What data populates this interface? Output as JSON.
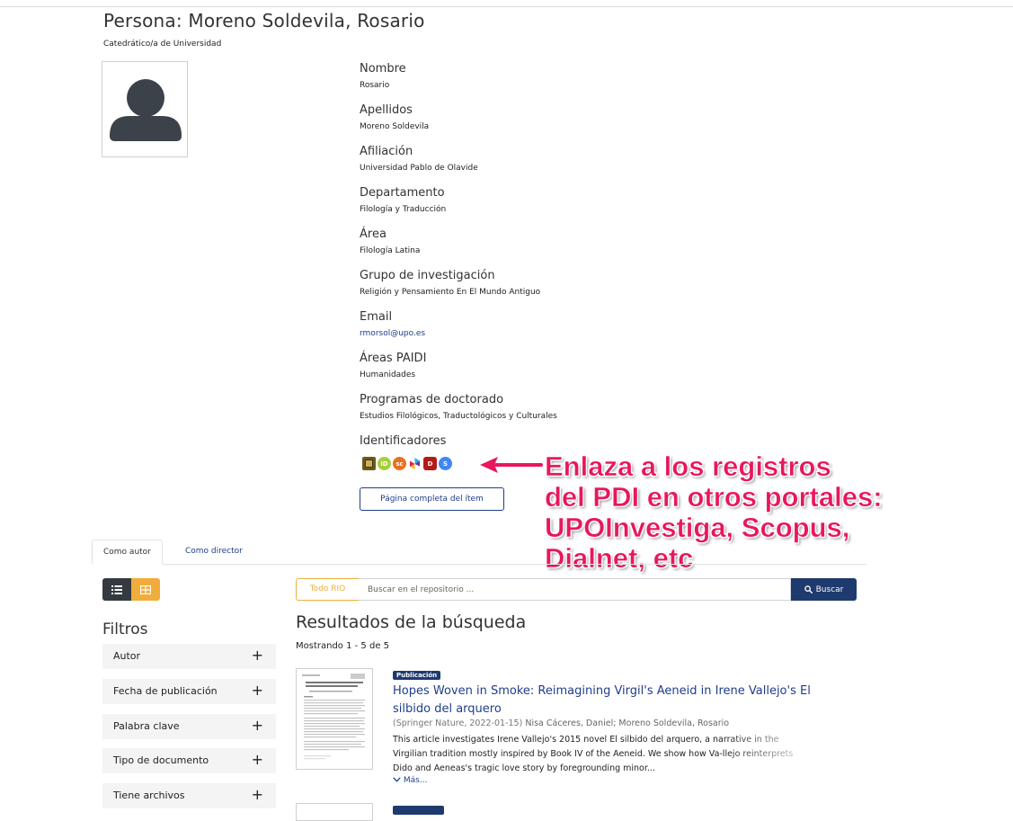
{
  "header": {
    "title": "Persona: Moreno Soldevila, Rosario",
    "subtitle": "Catedrático/a de Universidad"
  },
  "profile": {
    "avatar_icon": "user-silhouette-icon",
    "fields": [
      {
        "label": "Nombre",
        "value": "Rosario"
      },
      {
        "label": "Apellidos",
        "value": "Moreno Soldevila"
      },
      {
        "label": "Afiliación",
        "value": "Universidad Pablo de Olavide"
      },
      {
        "label": "Departamento",
        "value": "Filología y Traducción"
      },
      {
        "label": "Área",
        "value": "Filología Latina"
      },
      {
        "label": "Grupo de investigación",
        "value": "Religión y Pensamiento En El Mundo Antiguo"
      },
      {
        "label": "Email",
        "value": "rmorsol@upo.es"
      },
      {
        "label": "Áreas PAIDI",
        "value": "Humanidades"
      },
      {
        "label": "Programas de doctorado",
        "value": "Estudios Filológicos, Traductológicos y Culturales"
      },
      {
        "label": "Identificadores",
        "value": ""
      }
    ],
    "identifier_icons": [
      {
        "name": "upoinvestiga-icon",
        "color": "#6b5a1e",
        "glyph": "▣"
      },
      {
        "name": "orcid-icon",
        "color": "#a6ce39",
        "glyph": "iD"
      },
      {
        "name": "scopus-icon",
        "color": "#e9711c",
        "glyph": "sc"
      },
      {
        "name": "publons-icon",
        "color": "#3d5aa8",
        "glyph": "◆"
      },
      {
        "name": "dialnet-icon",
        "color": "#b31b1b",
        "glyph": "D"
      },
      {
        "name": "google-scholar-icon",
        "color": "#4285f4",
        "glyph": "S"
      }
    ],
    "full_item_button": "Página completa del ítem"
  },
  "annotation": {
    "lines": [
      "Enlaza a los registros",
      "del PDI en otros portales:",
      "UPOInvestiga, Scopus,",
      "Dialnet, etc"
    ],
    "color": "#e8175d"
  },
  "tabs": [
    {
      "label": "Como autor",
      "active": true
    },
    {
      "label": "Como director",
      "active": false
    }
  ],
  "search": {
    "scope_label": "Todo RIO",
    "placeholder": "Buscar en el repositorio ...",
    "button_label": "Buscar"
  },
  "filters": {
    "title": "Filtros",
    "items": [
      "Autor",
      "Fecha de publicación",
      "Palabra clave",
      "Tipo de documento",
      "Tiene archivos"
    ],
    "expand_symbol": "+"
  },
  "results": {
    "title": "Resultados de la búsqueda",
    "showing": "Mostrando 1 - 5 de 5",
    "items": [
      {
        "badge": "Publicación",
        "title": "Hopes Woven in Smoke: Reimagining Virgil's Aeneid in Irene Vallejo's El silbido del arquero",
        "publisher": "(Springer Nature, 2022-01-15)",
        "authors": "Nisa Cáceres, Daniel; Moreno Soldevila, Rosario",
        "abstract": "This article investigates Irene Vallejo's 2015 novel El silbido del arquero, a narrative in the Virgilian tradition mostly inspired by Book IV of the Aeneid. We show how Va-llejo reinterprets Dido and Aeneas's tragic love story by foregrounding minor...",
        "more": "Más..."
      }
    ]
  },
  "colors": {
    "primary": "#1e3a6f",
    "link": "#1f3d8a",
    "accent": "#f0ad3b",
    "dark": "#343a40"
  }
}
